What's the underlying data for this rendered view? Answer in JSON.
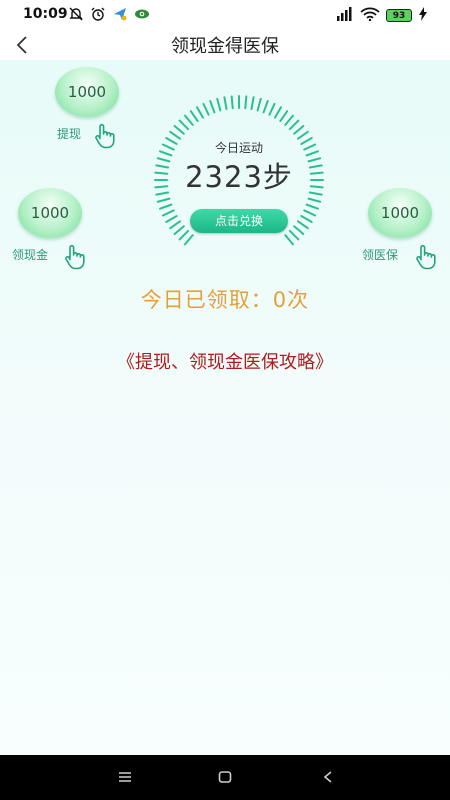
{
  "status_bar": {
    "time": "10:09",
    "battery": "93",
    "icons": [
      "muted-bell-icon",
      "alarm-icon",
      "app-notification-icon",
      "eye-icon",
      "signal-icon",
      "wifi-icon",
      "battery-icon",
      "charging-icon"
    ]
  },
  "nav": {
    "title": "领现金得医保"
  },
  "bubbles": {
    "withdraw": {
      "value": "1000",
      "label": "提现"
    },
    "cash": {
      "value": "1000",
      "label": "领现金"
    },
    "insurance": {
      "value": "1000",
      "label": "领医保"
    }
  },
  "steps": {
    "title": "今日运动",
    "value": "2323步",
    "button": "点击兑换"
  },
  "claimed_text": "今日已领取：0次",
  "guide_link": "《提现、领现金医保攻略》",
  "colors": {
    "accent_green": "#1bb786",
    "claimed_gold": "#e2a23a",
    "link_red": "#b11b1b"
  }
}
